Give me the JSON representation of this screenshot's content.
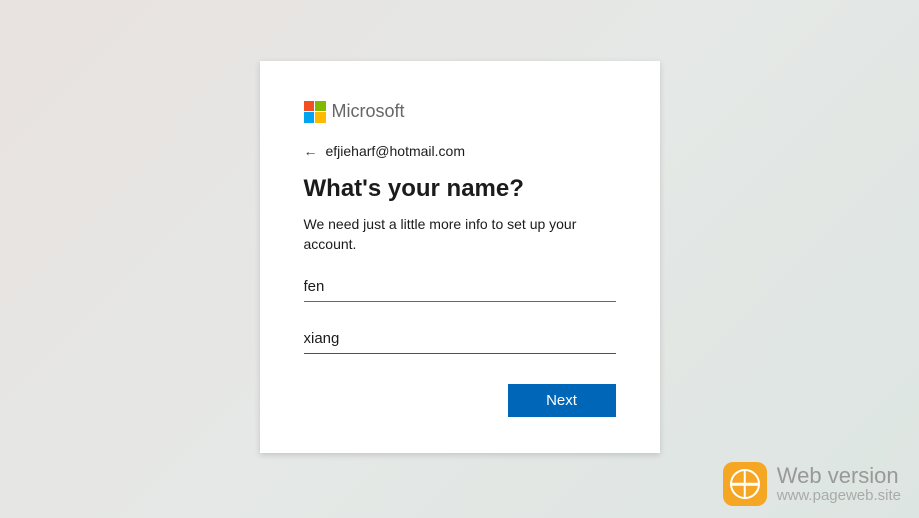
{
  "brand": "Microsoft",
  "back": {
    "email": "efjieharf@hotmail.com"
  },
  "title": "What's your name?",
  "subtitle": "We need just a little more info to set up your account.",
  "fields": {
    "first_name": "fen",
    "last_name": "xiang"
  },
  "buttons": {
    "next": "Next"
  },
  "watermark": {
    "title": "Web version",
    "url": "www.pageweb.site"
  }
}
